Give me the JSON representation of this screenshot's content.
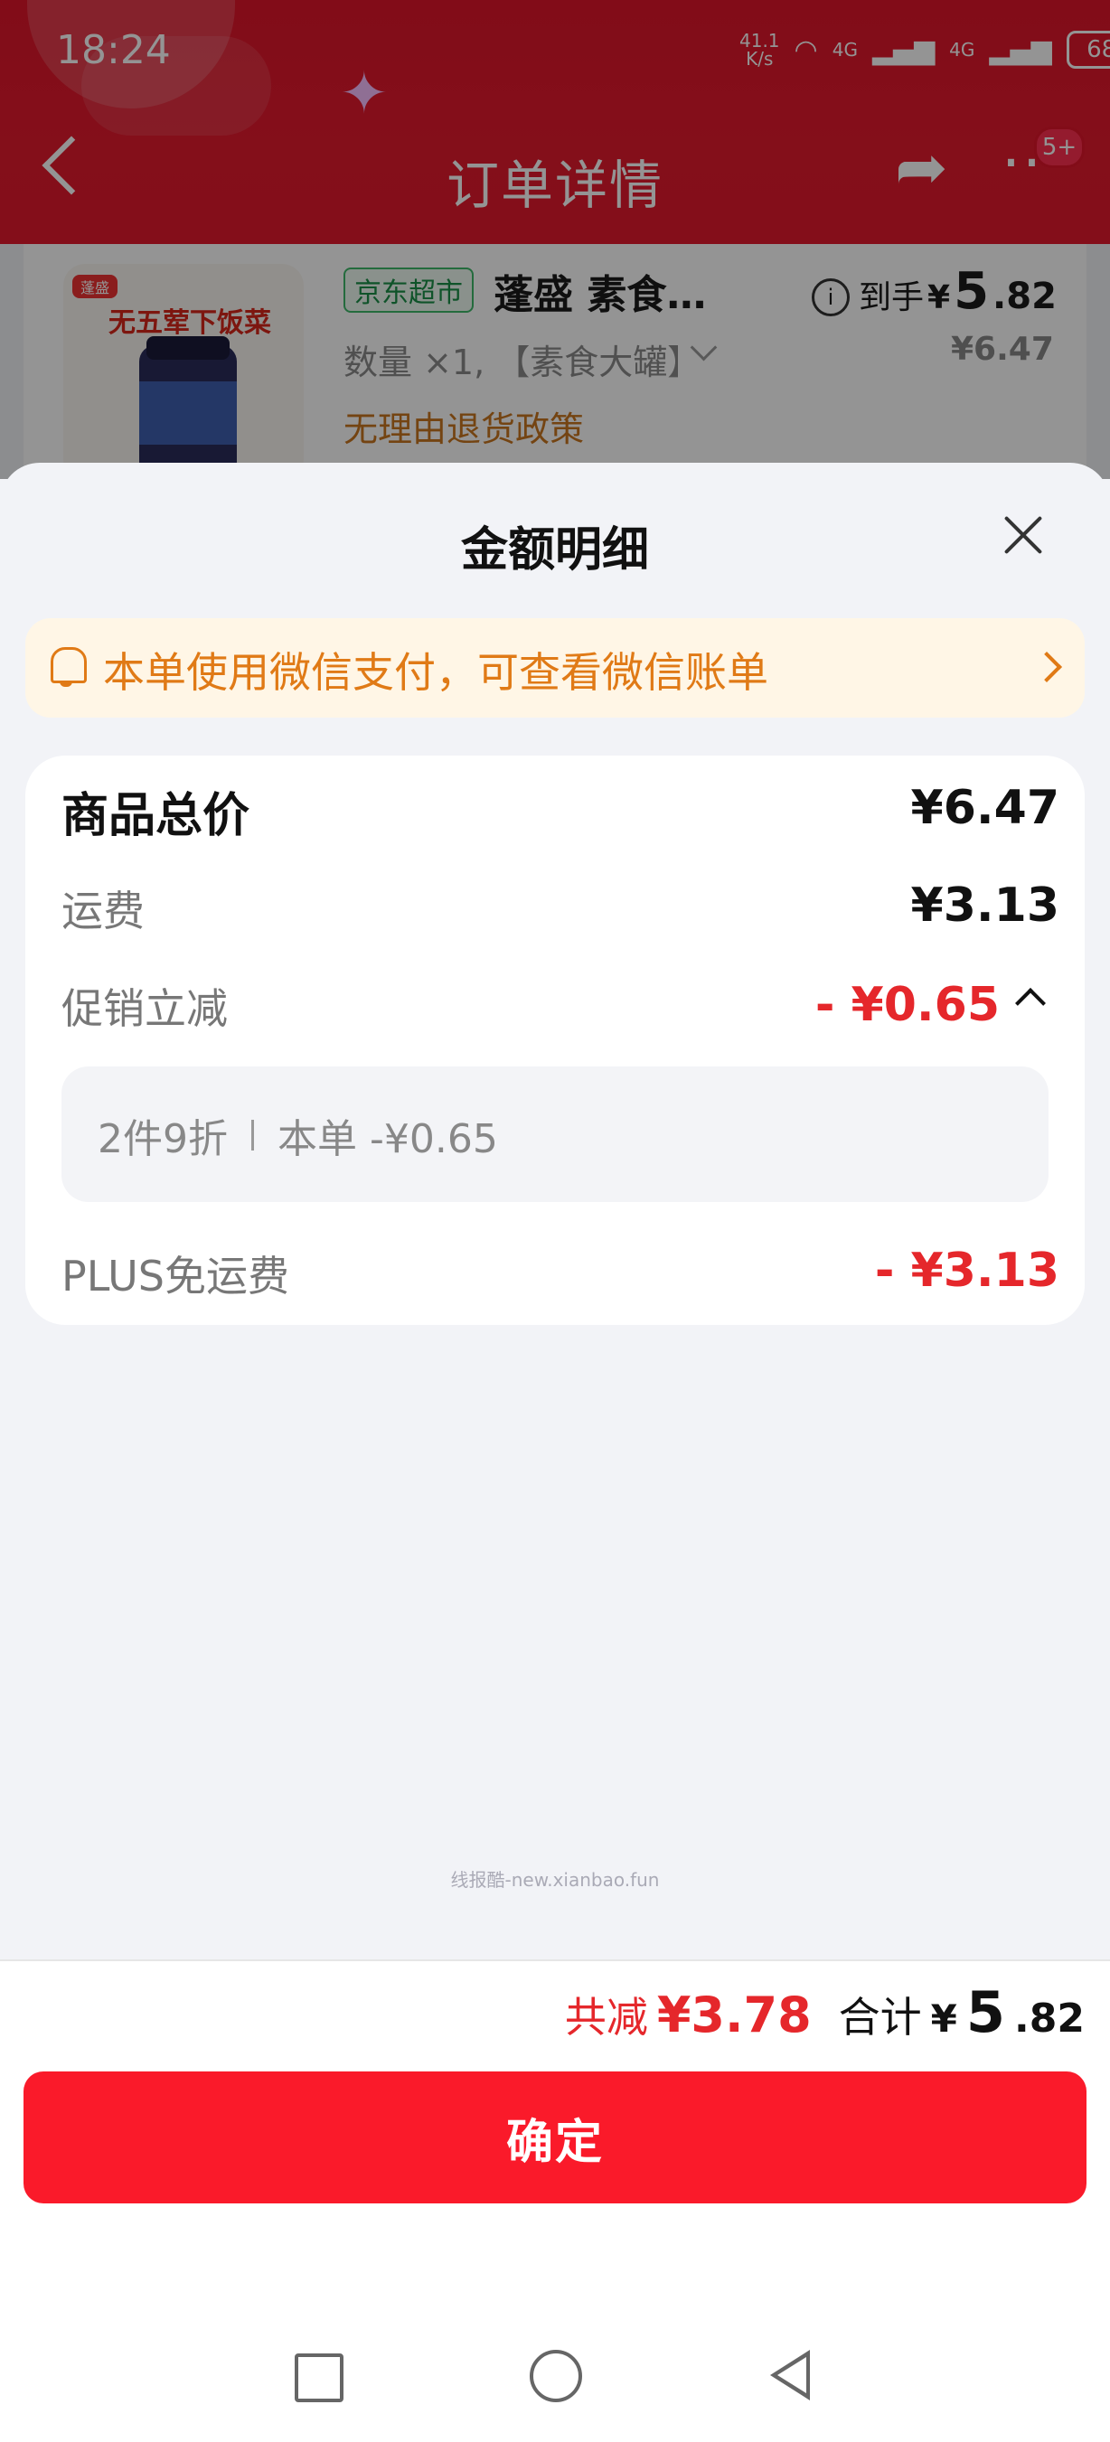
{
  "status_bar": {
    "time": "18:24",
    "net_speed_value": "41.1",
    "net_speed_unit": "K/s",
    "signal1": "4G",
    "signal2": "4G",
    "battery": "68"
  },
  "nav": {
    "title": "订单详情",
    "badge": "5+"
  },
  "product": {
    "shop_tag": "京东超市",
    "name": "蓬盛 素食…",
    "arrive_label": "到手",
    "arrive_yen": "¥",
    "arrive_int": "5",
    "arrive_dec": ".82",
    "original_price": "¥6.47",
    "quantity": "数量 ×1, 【素食大罐】",
    "policy": "无理由退货政策",
    "thumb_text": "无五荤下饭菜"
  },
  "sheet": {
    "title": "金额明细",
    "notice": "本单使用微信支付，可查看微信账单",
    "rows": {
      "goods_label": "商品总价",
      "goods_value": "¥6.47",
      "shipping_label": "运费",
      "shipping_value": "¥3.13",
      "promo_label": "促销立减",
      "promo_value": "- ¥0.65",
      "promo_detail_name": "2件9折",
      "promo_detail_value": "本单 -¥0.65",
      "plus_label": "PLUS免运费",
      "plus_value": "- ¥3.13"
    },
    "watermark": "线报酷-new.xianbao.fun"
  },
  "footer": {
    "save_label": "共减",
    "save_value": "¥3.78",
    "total_label": "合计",
    "total_yen": "¥",
    "total_int": "5",
    "total_dec": ".82",
    "confirm": "确定"
  },
  "colors": {
    "brand_red": "#e0162a",
    "confirm_red": "#fa1a2a",
    "discount_red": "#e5272b",
    "notice_orange": "#e07a16"
  },
  "icons": [
    "back-icon",
    "share-icon",
    "more-icon",
    "info-icon",
    "chevron-down-icon",
    "close-icon",
    "bell-icon",
    "chevron-right-icon",
    "chevron-up-icon",
    "square-nav-icon",
    "home-nav-icon",
    "back-nav-icon"
  ]
}
